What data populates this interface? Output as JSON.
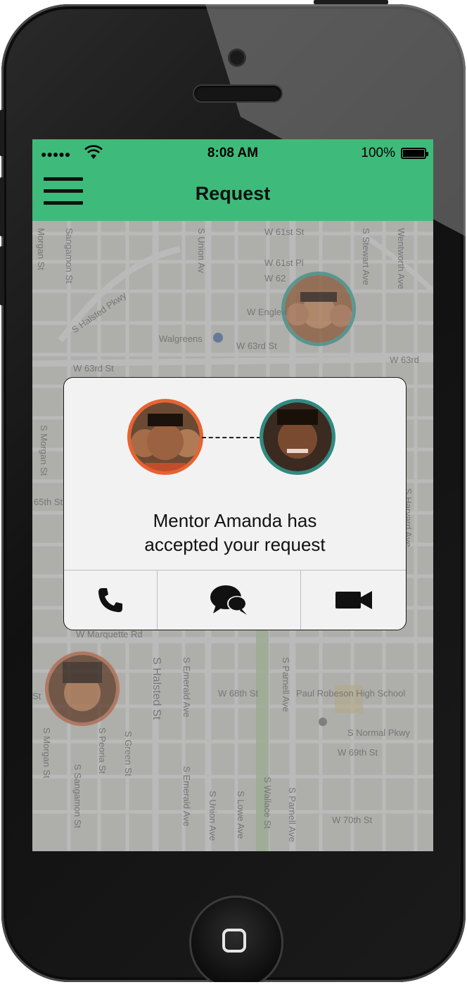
{
  "status_bar": {
    "signal": "●●●●●",
    "time": "8:08 AM",
    "battery": "100%"
  },
  "nav": {
    "title": "Request"
  },
  "map": {
    "streets": [
      "W 61st St",
      "W 61st Pl",
      "W 62",
      "W Englew",
      "W 63rd St",
      "W 63rd St",
      "W 63rd",
      "S Halsted Pkwy",
      "S Union Av",
      "S Stewart Ave",
      "Wentworth Ave",
      "Morgan St",
      "Sangamon St",
      "S Morgan St",
      "65th St",
      "S Harvard Ave",
      "W Marquette Rd",
      "S Halsted St",
      "S Emerald Ave",
      "W 68th St",
      "S Parnell Ave",
      "S Normal Pkwy",
      "W 69th St",
      "S Morgan St",
      "S Peoria St",
      "S Green St",
      "S Sangamon St",
      "S Emerald Ave",
      "S Union Ave",
      "S Lowe Ave",
      "S Wallace St",
      "S Parnell Ave",
      "W 70th St",
      "St"
    ],
    "places": [
      "Walgreens",
      "Paul Robeson High School"
    ]
  },
  "dialog": {
    "message_line1": "Mentor Amanda has",
    "message_line2": "accepted your request",
    "actions": [
      "phone-icon",
      "chat-icon",
      "video-camera-icon"
    ]
  },
  "colors": {
    "brand_green": "#3ebb7a",
    "mentee_ring": "#e9622f",
    "mentor_ring": "#2e8b82"
  }
}
